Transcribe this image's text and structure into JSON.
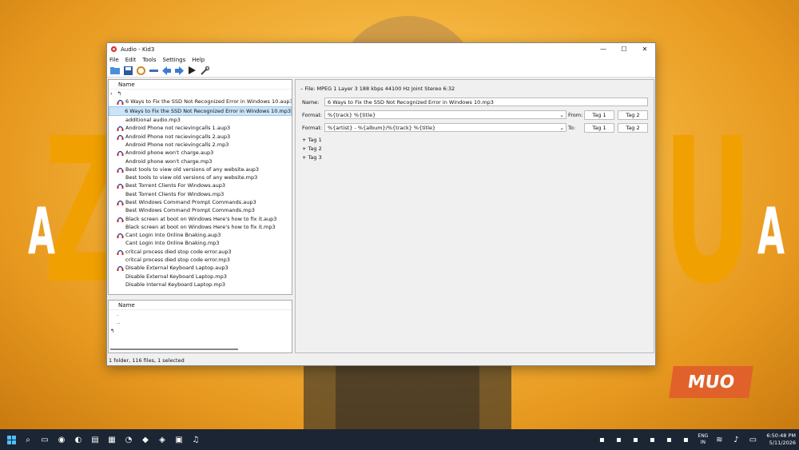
{
  "background": {
    "letters": [
      "Z",
      "A",
      "U",
      "A"
    ],
    "brand": "MUO"
  },
  "window": {
    "title": "Audio - Kid3",
    "controls": {
      "minimize": "—",
      "maximize": "☐",
      "close": "✕"
    }
  },
  "menu": [
    "File",
    "Edit",
    "Tools",
    "Settings",
    "Help"
  ],
  "toolbar": [
    "open-folder",
    "save",
    "revert",
    "remove",
    "previous",
    "next",
    "play",
    "settings"
  ],
  "file_list": {
    "header": "Name",
    "items": [
      {
        "label": "6 Ways to Fix the SSD Not Recognized Error in Windows 10.aup3",
        "type": "aup3"
      },
      {
        "label": "6 Ways to Fix the SSD Not Recognized Error in Windows 10.mp3",
        "type": "mp3",
        "selected": true
      },
      {
        "label": "additional audio.mp3",
        "type": "mp3"
      },
      {
        "label": "Android Phone not recievingcalls 1.aup3",
        "type": "aup3"
      },
      {
        "label": "Android Phone not recievingcalls 2.aup3",
        "type": "aup3"
      },
      {
        "label": "Android Phone not recievingcalls 2.mp3",
        "type": "mp3"
      },
      {
        "label": "Android phone won't charge.aup3",
        "type": "aup3"
      },
      {
        "label": "Android phone won't charge.mp3",
        "type": "mp3"
      },
      {
        "label": "Best tools to view old versions of any website.aup3",
        "type": "aup3"
      },
      {
        "label": "Best tools to view old versions of any website.mp3",
        "type": "mp3"
      },
      {
        "label": "Best Torrent Clients For Windows.aup3",
        "type": "aup3"
      },
      {
        "label": "Best Torrent Clients For Windows.mp3",
        "type": "mp3"
      },
      {
        "label": "Best Windows Command Prompt Commands.aup3",
        "type": "aup3"
      },
      {
        "label": "Best Windows Command Prompt Commands.mp3",
        "type": "mp3"
      },
      {
        "label": "Black screen at boot on Windows Here's how to fix it.aup3",
        "type": "aup3"
      },
      {
        "label": "Black screen at boot on Windows Here's how to fix it.mp3",
        "type": "mp3"
      },
      {
        "label": "Cant Login Into Online Bnaking.aup3",
        "type": "aup3"
      },
      {
        "label": "Cant Login Into Online Bnaking.mp3",
        "type": "mp3"
      },
      {
        "label": "critcal process died stop code error.aup3",
        "type": "aup3"
      },
      {
        "label": "critcal process died stop code error.mp3",
        "type": "mp3"
      },
      {
        "label": "Disable External Keyboard Laptop.aup3",
        "type": "aup3"
      },
      {
        "label": "Disable External Keyboard Laptop.mp3",
        "type": "mp3"
      },
      {
        "label": "Disable Internal Keyboard Laptop.mp3",
        "type": "mp3"
      }
    ]
  },
  "dir_list": {
    "header": "Name",
    "items": [
      ".",
      ".."
    ]
  },
  "tag_panel": {
    "file_info": "File: MPEG 1 Layer 3 188 kbps 44100 Hz Joint Stereo 6:32",
    "name_label": "Name:",
    "name_value": "6 Ways to Fix the SSD Not Recognized Error in Windows 10.mp3",
    "format1_label": "Format:",
    "format1_value": "%{track} %{title}",
    "from_label": "From:",
    "format2_label": "Format:",
    "format2_value": "%{artist} - %{album}/%{track} %{title}",
    "to_label": "To:",
    "tag1_btn": "Tag 1",
    "tag2_btn": "Tag 2",
    "tags": [
      "Tag 1",
      "Tag 2",
      "Tag 3"
    ]
  },
  "status": "1 folder, 116 files, 1 selected",
  "taskbar": {
    "lang": "ENG",
    "region": "IN",
    "time": "6:50:48 PM",
    "date": "5/11/2026"
  }
}
